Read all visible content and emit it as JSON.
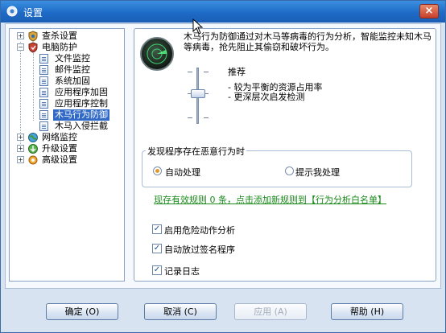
{
  "window": {
    "title": "设置",
    "close_label": "×"
  },
  "tree": {
    "items": [
      {
        "label": "查杀设置",
        "icon": "scan-shield-icon",
        "expander": "+"
      },
      {
        "label": "电脑防护",
        "icon": "protection-shield-icon",
        "expander": "−"
      },
      {
        "label": "文件监控",
        "icon": "document-icon"
      },
      {
        "label": "邮件监控",
        "icon": "document-icon"
      },
      {
        "label": "系统加固",
        "icon": "document-icon"
      },
      {
        "label": "应用程序加固",
        "icon": "document-icon"
      },
      {
        "label": "应用程序控制",
        "icon": "document-icon"
      },
      {
        "label": "木马行为防御",
        "icon": "document-icon",
        "selected": true
      },
      {
        "label": "木马入侵拦截",
        "icon": "document-icon"
      },
      {
        "label": "网络监控",
        "icon": "network-globe-icon",
        "expander": "+"
      },
      {
        "label": "升级设置",
        "icon": "update-globe-icon",
        "expander": "+"
      },
      {
        "label": "高级设置",
        "icon": "advanced-gear-icon",
        "expander": "+"
      }
    ]
  },
  "panel": {
    "description": "木马行为防御通过对木马等病毒的行为分析，智能监控未知木马等病毒，抢先阻止其偷窃和破坏行为。",
    "level": {
      "title": "推荐",
      "line1": "- 较为平衡的资源占用率",
      "line2": "- 更深层次启发检测"
    },
    "group_title": "发现程序存在恶意行为时",
    "radio_auto": "自动处理",
    "radio_prompt": "提示我处理",
    "whitelist_link": "现存有效规则 0 条，点击添加新规则到【行为分析白名单】",
    "checkboxes": [
      {
        "label": "启用危险动作分析",
        "checked": true
      },
      {
        "label": "自动放过签名程序",
        "checked": true
      },
      {
        "label": "记录日志",
        "checked": true
      }
    ]
  },
  "buttons": {
    "ok": "确定 (O)",
    "cancel": "取消 (C)",
    "apply": "应用 (A)",
    "help": "帮助 (H)"
  },
  "colors": {
    "titlebar": "#1e6bc7",
    "selection": "#3169c6",
    "link": "#1a8a1a",
    "radio_dot": "#e09a2c"
  }
}
